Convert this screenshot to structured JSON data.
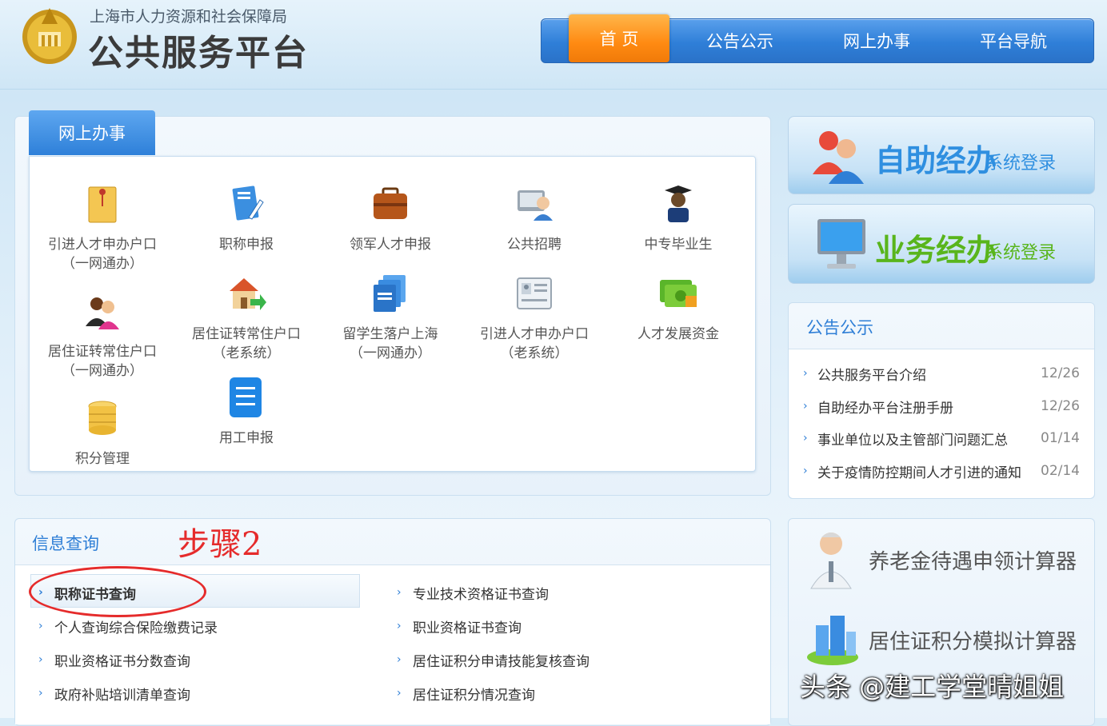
{
  "header": {
    "org_name": "上海市人力资源和社会保障局",
    "platform_title": "公共服务平台"
  },
  "nav": [
    {
      "label": "首 页",
      "active": true
    },
    {
      "label": "公告公示",
      "active": false
    },
    {
      "label": "网上办事",
      "active": false
    },
    {
      "label": "平台导航",
      "active": false
    }
  ],
  "online_services": {
    "tab_label": "网上办事",
    "items": [
      {
        "line1": "引进人才申办户口",
        "line2": "（一网通办）",
        "icon": "envelope-icon"
      },
      {
        "line1": "职称申报",
        "line2": "",
        "icon": "document-pen-icon"
      },
      {
        "line1": "领军人才申报",
        "line2": "",
        "icon": "briefcase-icon"
      },
      {
        "line1": "公共招聘",
        "line2": "",
        "icon": "recruiter-icon"
      },
      {
        "line1": "中专毕业生",
        "line2": "",
        "icon": "graduate-icon"
      },
      {
        "line1": "居住证转常住户口",
        "line2": "（一网通办）",
        "icon": "people-icon"
      },
      {
        "line1": "居住证转常住户口",
        "line2": "（老系统）",
        "icon": "house-arrow-icon"
      },
      {
        "line1": "留学生落户上海",
        "line2": "（一网通办）",
        "icon": "stacked-docs-icon"
      },
      {
        "line1": "引进人才申办户口",
        "line2": "（老系统）",
        "icon": "id-card-icon"
      },
      {
        "line1": "人才发展资金",
        "line2": "",
        "icon": "money-icon"
      },
      {
        "line1": "积分管理",
        "line2": "",
        "icon": "coins-icon"
      },
      {
        "line1": "用工申报",
        "line2": "",
        "icon": "list-doc-icon"
      }
    ]
  },
  "banners": {
    "self_service": {
      "main": "自助经办",
      "sub": "系统登录"
    },
    "business": {
      "main": "业务经办",
      "sub": "系统登录"
    }
  },
  "notices": {
    "title": "公告公示",
    "items": [
      {
        "text": "公共服务平台介绍",
        "date": "12/26"
      },
      {
        "text": "自助经办平台注册手册",
        "date": "12/26"
      },
      {
        "text": "事业单位以及主管部门问题汇总",
        "date": "01/14"
      },
      {
        "text": "关于疫情防控期间人才引进的通知",
        "date": "02/14"
      }
    ]
  },
  "info_query": {
    "title": "信息查询",
    "annotation": "步骤2",
    "left": [
      "职称证书查询",
      "个人查询综合保险缴费记录",
      "职业资格证书分数查询",
      "政府补贴培训清单查询"
    ],
    "right": [
      "专业技术资格证书查询",
      "职业资格证书查询",
      "居住证积分申请技能复核查询",
      "居住证积分情况查询"
    ]
  },
  "calculators": {
    "pension": "养老金待遇申领计算器",
    "points": "居住证积分模拟计算器"
  },
  "watermark": "头条 @建工学堂晴姐姐",
  "colors": {
    "accent_blue": "#2f7fd6",
    "nav_active_orange": "#ff8a12",
    "annotation_red": "#e52b2b",
    "business_green": "#59b51c"
  }
}
